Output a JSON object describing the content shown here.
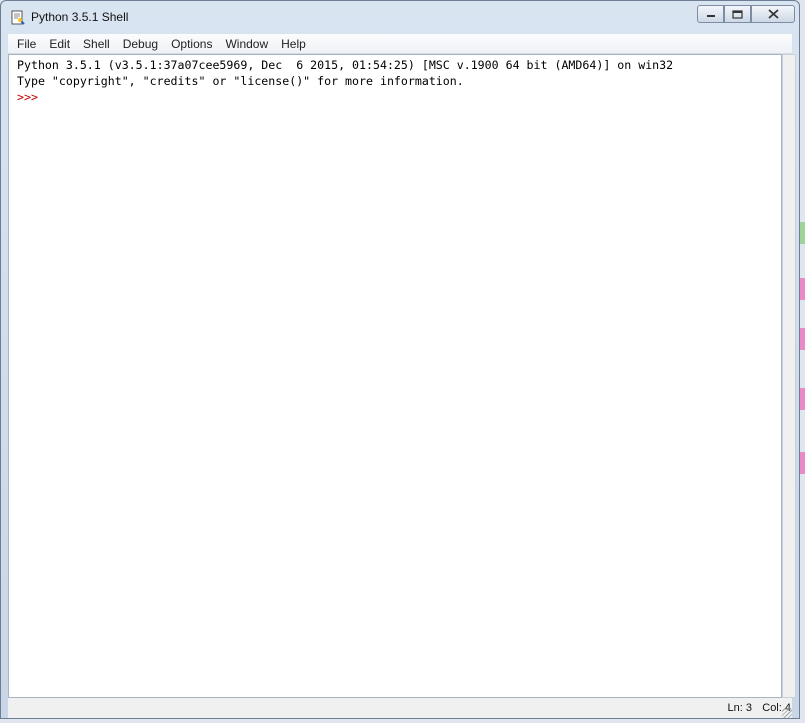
{
  "window": {
    "title": "Python 3.5.1 Shell",
    "icon": "python-idle-icon",
    "controls": {
      "minimize": "minimize-icon",
      "maximize": "maximize-icon",
      "close": "close-icon"
    }
  },
  "menubar": {
    "items": [
      "File",
      "Edit",
      "Shell",
      "Debug",
      "Options",
      "Window",
      "Help"
    ]
  },
  "shell": {
    "lines": [
      "Python 3.5.1 (v3.5.1:37a07cee5969, Dec  6 2015, 01:54:25) [MSC v.1900 64 bit (AMD64)] on win32",
      "Type \"copyright\", \"credits\" or \"license()\" for more information."
    ],
    "prompt": ">>>"
  },
  "status": {
    "line": "Ln: 3",
    "col": "Col: 4"
  },
  "colors": {
    "prompt": "#c00000",
    "editor_bg": "#ffffff"
  }
}
